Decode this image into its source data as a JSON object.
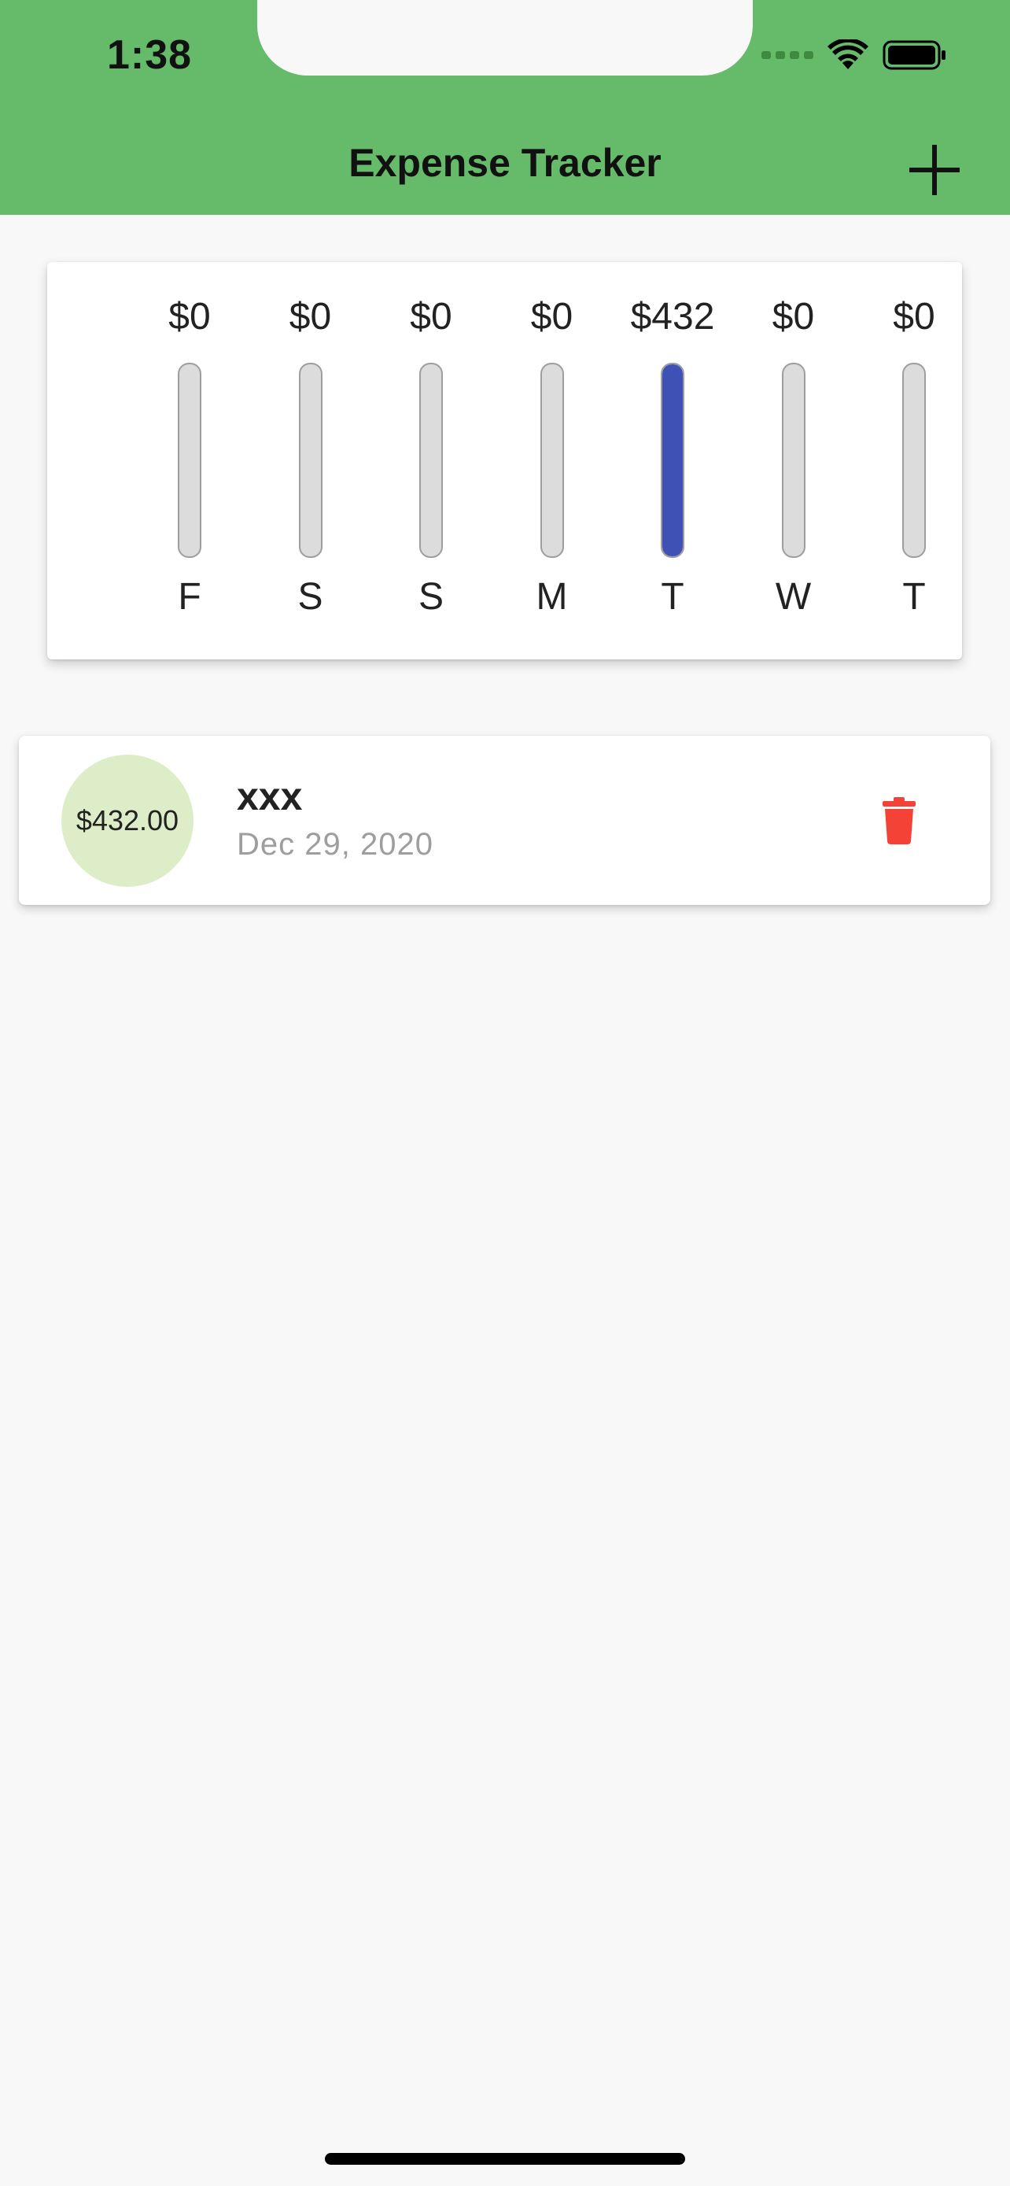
{
  "status_bar": {
    "time": "1:38",
    "icons": [
      "signal-dots-icon",
      "wifi-icon",
      "battery-icon"
    ]
  },
  "app_bar": {
    "title": "Expense Tracker",
    "add_icon": "plus-icon",
    "color": "#66bb6a"
  },
  "chart_data": {
    "type": "bar",
    "categories": [
      "F",
      "S",
      "S",
      "M",
      "T",
      "W",
      "T"
    ],
    "values": [
      0,
      0,
      0,
      0,
      432,
      0,
      0
    ],
    "value_labels": [
      "$0",
      "$0",
      "$0",
      "$0",
      "$432",
      "$0",
      "$0"
    ],
    "fill_fraction": [
      0,
      0,
      0,
      0,
      1,
      0,
      0
    ],
    "bar_color": "#3f51b5",
    "track_color": "#dcdcdc"
  },
  "transactions": [
    {
      "amount": "$432.00",
      "title": "xxx",
      "date": "Dec 29, 2020",
      "delete_icon": "trash-icon"
    }
  ],
  "colors": {
    "accent": "#66bb6a",
    "bar": "#3f51b5",
    "delete": "#f44336",
    "avatar_bg": "#dcedc8"
  }
}
